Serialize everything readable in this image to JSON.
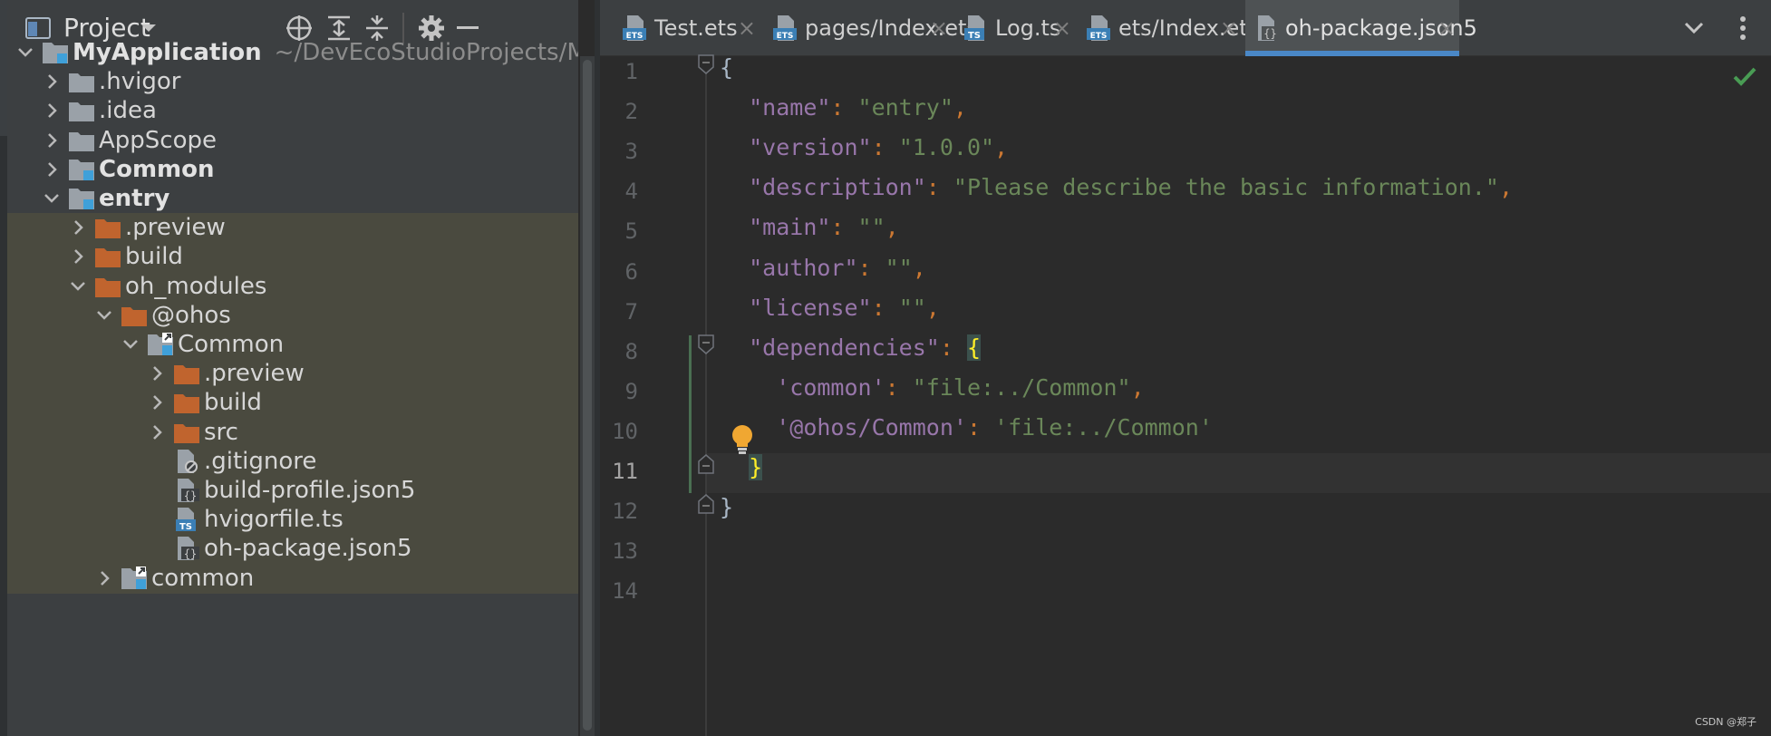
{
  "project_panel": {
    "title": "Project",
    "tree": [
      {
        "label": "MyApplication",
        "path": "~/DevEcoStudioProjects/M",
        "bold": true
      },
      {
        "label": ".hvigor"
      },
      {
        "label": ".idea"
      },
      {
        "label": "AppScope"
      },
      {
        "label": "Common",
        "bold": true
      },
      {
        "label": "entry",
        "bold": true
      },
      {
        "label": ".preview"
      },
      {
        "label": "build"
      },
      {
        "label": "oh_modules"
      },
      {
        "label": "@ohos"
      },
      {
        "label": "Common"
      },
      {
        "label": ".preview"
      },
      {
        "label": "build"
      },
      {
        "label": "src"
      },
      {
        "label": ".gitignore"
      },
      {
        "label": "build-profile.json5"
      },
      {
        "label": "hvigorfile.ts"
      },
      {
        "label": "oh-package.json5"
      },
      {
        "label": "common"
      }
    ]
  },
  "tabs": [
    {
      "label": "Test.ets",
      "icon": "ets-file-icon"
    },
    {
      "label": "pages/Index.ets",
      "icon": "ets-file-icon"
    },
    {
      "label": "Log.ts",
      "icon": "ts-file-icon"
    },
    {
      "label": "ets/Index.ets",
      "icon": "ets-file-icon"
    },
    {
      "label": "oh-package.json5",
      "icon": "json5-file-icon",
      "active": true
    }
  ],
  "tab_close_glyph": "×",
  "editor": {
    "line_numbers": [
      "1",
      "2",
      "3",
      "4",
      "5",
      "6",
      "7",
      "8",
      "9",
      "10",
      "11",
      "12",
      "13",
      "14"
    ],
    "current_line": "11",
    "lines": [
      [
        {
          "t": "{",
          "c": "b"
        }
      ],
      [
        {
          "t": "  "
        },
        {
          "t": "\"name\"",
          "c": "k"
        },
        {
          "t": ": ",
          "c": "p"
        },
        {
          "t": "\"entry\"",
          "c": "s"
        },
        {
          "t": ",",
          "c": "p"
        }
      ],
      [
        {
          "t": "  "
        },
        {
          "t": "\"version\"",
          "c": "k"
        },
        {
          "t": ": ",
          "c": "p"
        },
        {
          "t": "\"1.0.0\"",
          "c": "s"
        },
        {
          "t": ",",
          "c": "p"
        }
      ],
      [
        {
          "t": "  "
        },
        {
          "t": "\"description\"",
          "c": "k"
        },
        {
          "t": ": ",
          "c": "p"
        },
        {
          "t": "\"Please describe the basic information.\"",
          "c": "s"
        },
        {
          "t": ",",
          "c": "p"
        }
      ],
      [
        {
          "t": "  "
        },
        {
          "t": "\"main\"",
          "c": "k"
        },
        {
          "t": ": ",
          "c": "p"
        },
        {
          "t": "\"\"",
          "c": "s"
        },
        {
          "t": ",",
          "c": "p"
        }
      ],
      [
        {
          "t": "  "
        },
        {
          "t": "\"author\"",
          "c": "k"
        },
        {
          "t": ": ",
          "c": "p"
        },
        {
          "t": "\"\"",
          "c": "s"
        },
        {
          "t": ",",
          "c": "p"
        }
      ],
      [
        {
          "t": "  "
        },
        {
          "t": "\"license\"",
          "c": "k"
        },
        {
          "t": ": ",
          "c": "p"
        },
        {
          "t": "\"\"",
          "c": "s"
        },
        {
          "t": ",",
          "c": "p"
        }
      ],
      [
        {
          "t": "  "
        },
        {
          "t": "\"dependencies\"",
          "c": "k"
        },
        {
          "t": ": ",
          "c": "p"
        },
        {
          "t": "{",
          "c": "bm"
        }
      ],
      [
        {
          "t": "    "
        },
        {
          "t": "'common'",
          "c": "k"
        },
        {
          "t": ": ",
          "c": "p"
        },
        {
          "t": "\"file:../Common\"",
          "c": "s"
        },
        {
          "t": ",",
          "c": "p"
        }
      ],
      [
        {
          "t": "    "
        },
        {
          "t": "'@ohos/Common'",
          "c": "k"
        },
        {
          "t": ": ",
          "c": "p"
        },
        {
          "t": "'file:../Common'",
          "c": "s"
        }
      ],
      [
        {
          "t": "  "
        },
        {
          "t": "}",
          "c": "bm"
        }
      ],
      [
        {
          "t": "}",
          "c": "b"
        }
      ],
      [],
      []
    ]
  },
  "watermark": "CSDN @郑子",
  "colors": {
    "panel_bg": "#3c3f41",
    "editor_bg": "#2b2b2b",
    "module_highlight": "#4a4a3f",
    "active_tab_underline": "#4a88c7",
    "key_purple": "#9876aa",
    "string_green": "#6a8759",
    "punct_orange": "#cc7832",
    "folder_orange": "#c0642e",
    "folder_grey": "#9aa1a8"
  }
}
